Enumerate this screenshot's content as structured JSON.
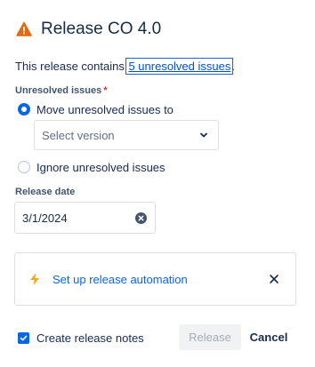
{
  "dialog": {
    "title": "Release CO 4.0",
    "intro_prefix": "This release contains ",
    "intro_link": "5 unresolved issues",
    "intro_suffix": "."
  },
  "unresolved": {
    "label": "Unresolved issues",
    "required_mark": "*",
    "options": [
      {
        "label": "Move unresolved issues to",
        "selected": true
      },
      {
        "label": "Ignore unresolved issues",
        "selected": false
      }
    ],
    "version_select_placeholder": "Select version"
  },
  "release_date": {
    "label": "Release date",
    "value": "3/1/2024"
  },
  "automation_banner": {
    "icon": "lightning-icon",
    "link_text": "Set up release automation"
  },
  "footer": {
    "create_notes_label": "Create release notes",
    "create_notes_checked": true,
    "release_button": "Release",
    "cancel_button": "Cancel"
  },
  "colors": {
    "primary": "#0c66e4",
    "warning": "#e56910",
    "text": "#172b4d",
    "required": "#c9372c"
  }
}
